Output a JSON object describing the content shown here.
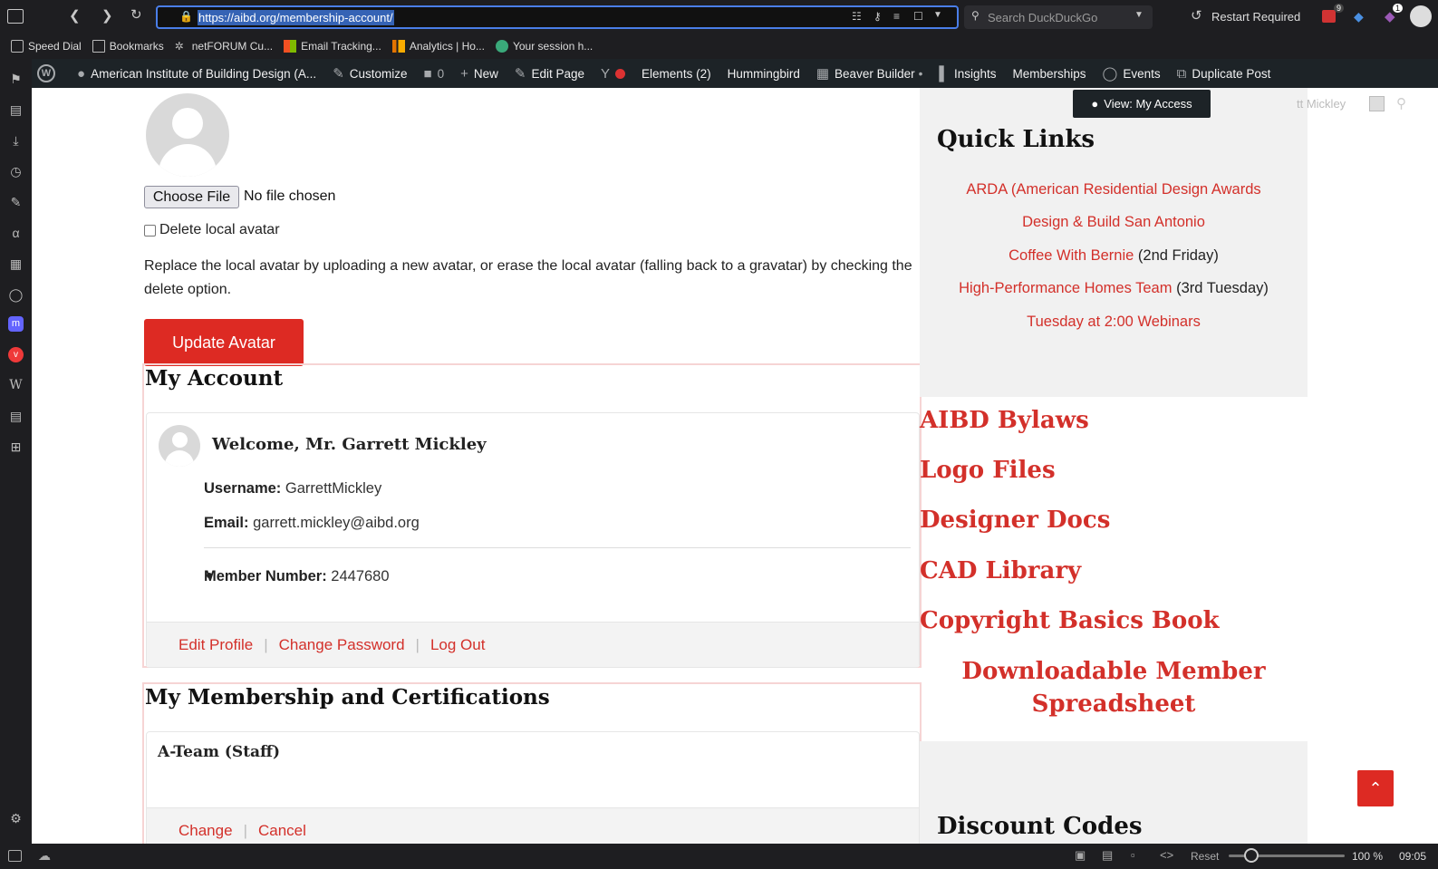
{
  "browser": {
    "url": "https://aibd.org/membership-account/",
    "search_placeholder": "Search DuckDuckGo",
    "restart_label": "Restart Required",
    "badge_mail": "9",
    "badge_ext": "1"
  },
  "bookmarks": [
    "Speed Dial",
    "Bookmarks",
    "netFORUM Cu...",
    "Email Tracking...",
    "Analytics | Ho...",
    "Your session h..."
  ],
  "wp_admin": {
    "site_name": "American Institute of Building Design (A...",
    "customize": "Customize",
    "comments": "0",
    "new": "New",
    "edit_page": "Edit Page",
    "elements": "Elements (2)",
    "hummingbird": "Hummingbird",
    "beaver": "Beaver Builder",
    "beaver_dot": "•",
    "insights": "Insights",
    "memberships": "Memberships",
    "events": "Events",
    "duplicate": "Duplicate Post",
    "user_partial": "tt Mickley"
  },
  "view_access": "View: My Access",
  "avatar_form": {
    "choose_file": "Choose File",
    "no_file": "No file chosen",
    "delete_label": "Delete local avatar",
    "description": "Replace the local avatar by uploading a new avatar, or erase the local avatar (falling back to a gravatar) by checking the delete option.",
    "update_button": "Update Avatar"
  },
  "my_account": {
    "title": "My Account",
    "welcome": "Welcome, Mr. Garrett Mickley",
    "username_label": "Username:",
    "username": "GarrettMickley",
    "email_label": "Email:",
    "email": "garrett.mickley@aibd.org",
    "member_number_label": "Member Number:",
    "member_number": "2447680",
    "links": [
      "Edit Profile",
      "Change Password",
      "Log Out"
    ],
    "separator": "|"
  },
  "membership": {
    "title": "My Membership and Certifications",
    "level": "A-Team (Staff)",
    "links": [
      "Change",
      "Cancel"
    ]
  },
  "quick_links": {
    "title": "Quick Links",
    "items": [
      {
        "link": "ARDA (American Residential Design Awards",
        "suffix": ""
      },
      {
        "link": "Design & Build San Antonio",
        "suffix": ""
      },
      {
        "link": "Coffee With Bernie",
        "suffix": " (2nd Friday)"
      },
      {
        "link": "High-Performance Homes Team",
        "suffix": " (3rd Tuesday)"
      },
      {
        "link": "Tuesday at 2:00 Webinars",
        "suffix": ""
      }
    ]
  },
  "resources": [
    "AIBD Bylaws",
    "Logo Files",
    "Designer Docs",
    "CAD Library",
    "Copyright Basics Book"
  ],
  "download_sheet": [
    "Downloadable Member",
    "Spreadsheet"
  ],
  "discount_title": "Discount Codes",
  "statusbar": {
    "reset": "Reset",
    "zoom": "100 %",
    "time": "09:05"
  },
  "colors": {
    "accent": "#dd2a23",
    "link": "#d3302a",
    "admin_bar": "#1d2327"
  }
}
